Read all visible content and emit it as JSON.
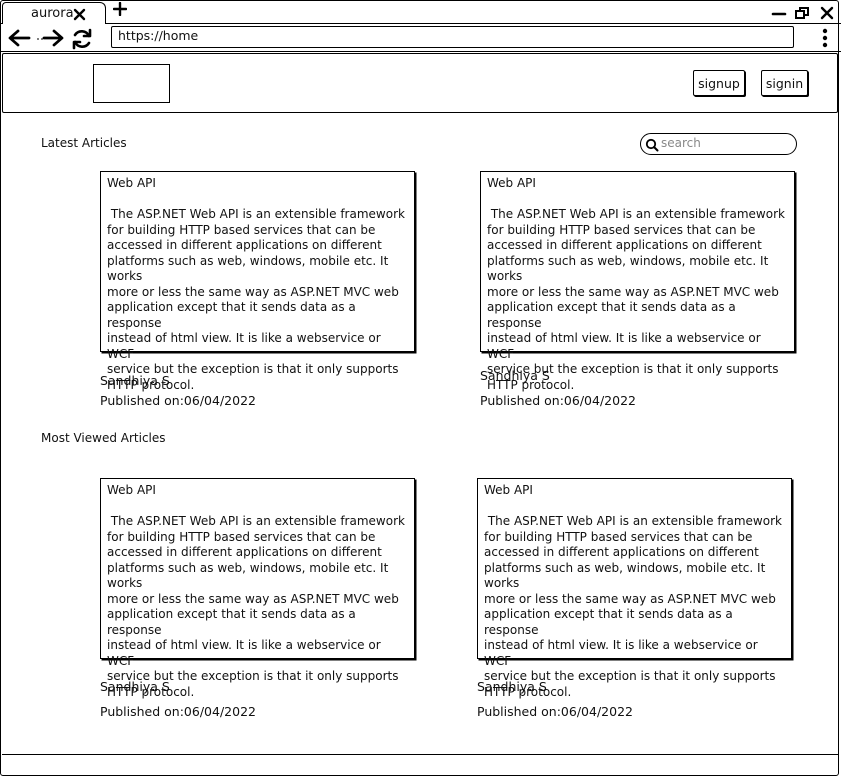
{
  "browser": {
    "tab_title": "aurora",
    "url": "https://home"
  },
  "header": {
    "signup_label": "signup",
    "signin_label": "signin"
  },
  "sections": {
    "latest_title": "Latest Articles",
    "most_viewed_title": "Most Viewed Articles"
  },
  "search": {
    "placeholder": "search",
    "value": ""
  },
  "articles": [
    {
      "title": "Web API",
      "body": " The ASP.NET Web API is an extensible framework\nfor building HTTP based services that can be\naccessed in different applications on different\nplatforms such as web, windows, mobile etc. It works\nmore or less the same way as ASP.NET MVC web\napplication except that it sends data as a response\ninstead of html view. It is like a webservice or WCF\nservice but the exception is that it only supports\nHTTP protocol.",
      "author": "Sandhiya S",
      "published": "Published on:06/04/2022"
    },
    {
      "title": "Web API",
      "body": " The ASP.NET Web API is an extensible framework\nfor building HTTP based services that can be\naccessed in different applications on different\nplatforms such as web, windows, mobile etc. It works\nmore or less the same way as ASP.NET MVC web\napplication except that it sends data as a response\ninstead of html view. It is like a webservice or WCF\nservice but the exception is that it only supports\nHTTP protocol.",
      "author": "Sandhiya S",
      "published": "Published on:06/04/2022"
    },
    {
      "title": "Web API",
      "body": " The ASP.NET Web API is an extensible framework\nfor building HTTP based services that can be\naccessed in different applications on different\nplatforms such as web, windows, mobile etc. It works\nmore or less the same way as ASP.NET MVC web\napplication except that it sends data as a response\ninstead of html view. It is like a webservice or WCF\nservice but the exception is that it only supports\nHTTP protocol.",
      "author": "Sandhiya S",
      "published": "Published on:06/04/2022"
    },
    {
      "title": "Web API",
      "body": " The ASP.NET Web API is an extensible framework\nfor building HTTP based services that can be\naccessed in different applications on different\nplatforms such as web, windows, mobile etc. It works\nmore or less the same way as ASP.NET MVC web\napplication except that it sends data as a response\ninstead of html view. It is like a webservice or WCF\nservice but the exception is that it only supports\nHTTP protocol.",
      "author": "Sandhiya S",
      "published": "Published on:06/04/2022"
    }
  ],
  "icons": {
    "tab_close": "close-icon",
    "new_tab": "plus-icon",
    "minimize": "minimize-icon",
    "restore": "restore-icon",
    "close": "close-icon",
    "back": "arrow-left-icon",
    "forward": "arrow-right-icon",
    "reload": "reload-icon",
    "menu": "kebab-menu-icon",
    "search": "search-icon"
  }
}
